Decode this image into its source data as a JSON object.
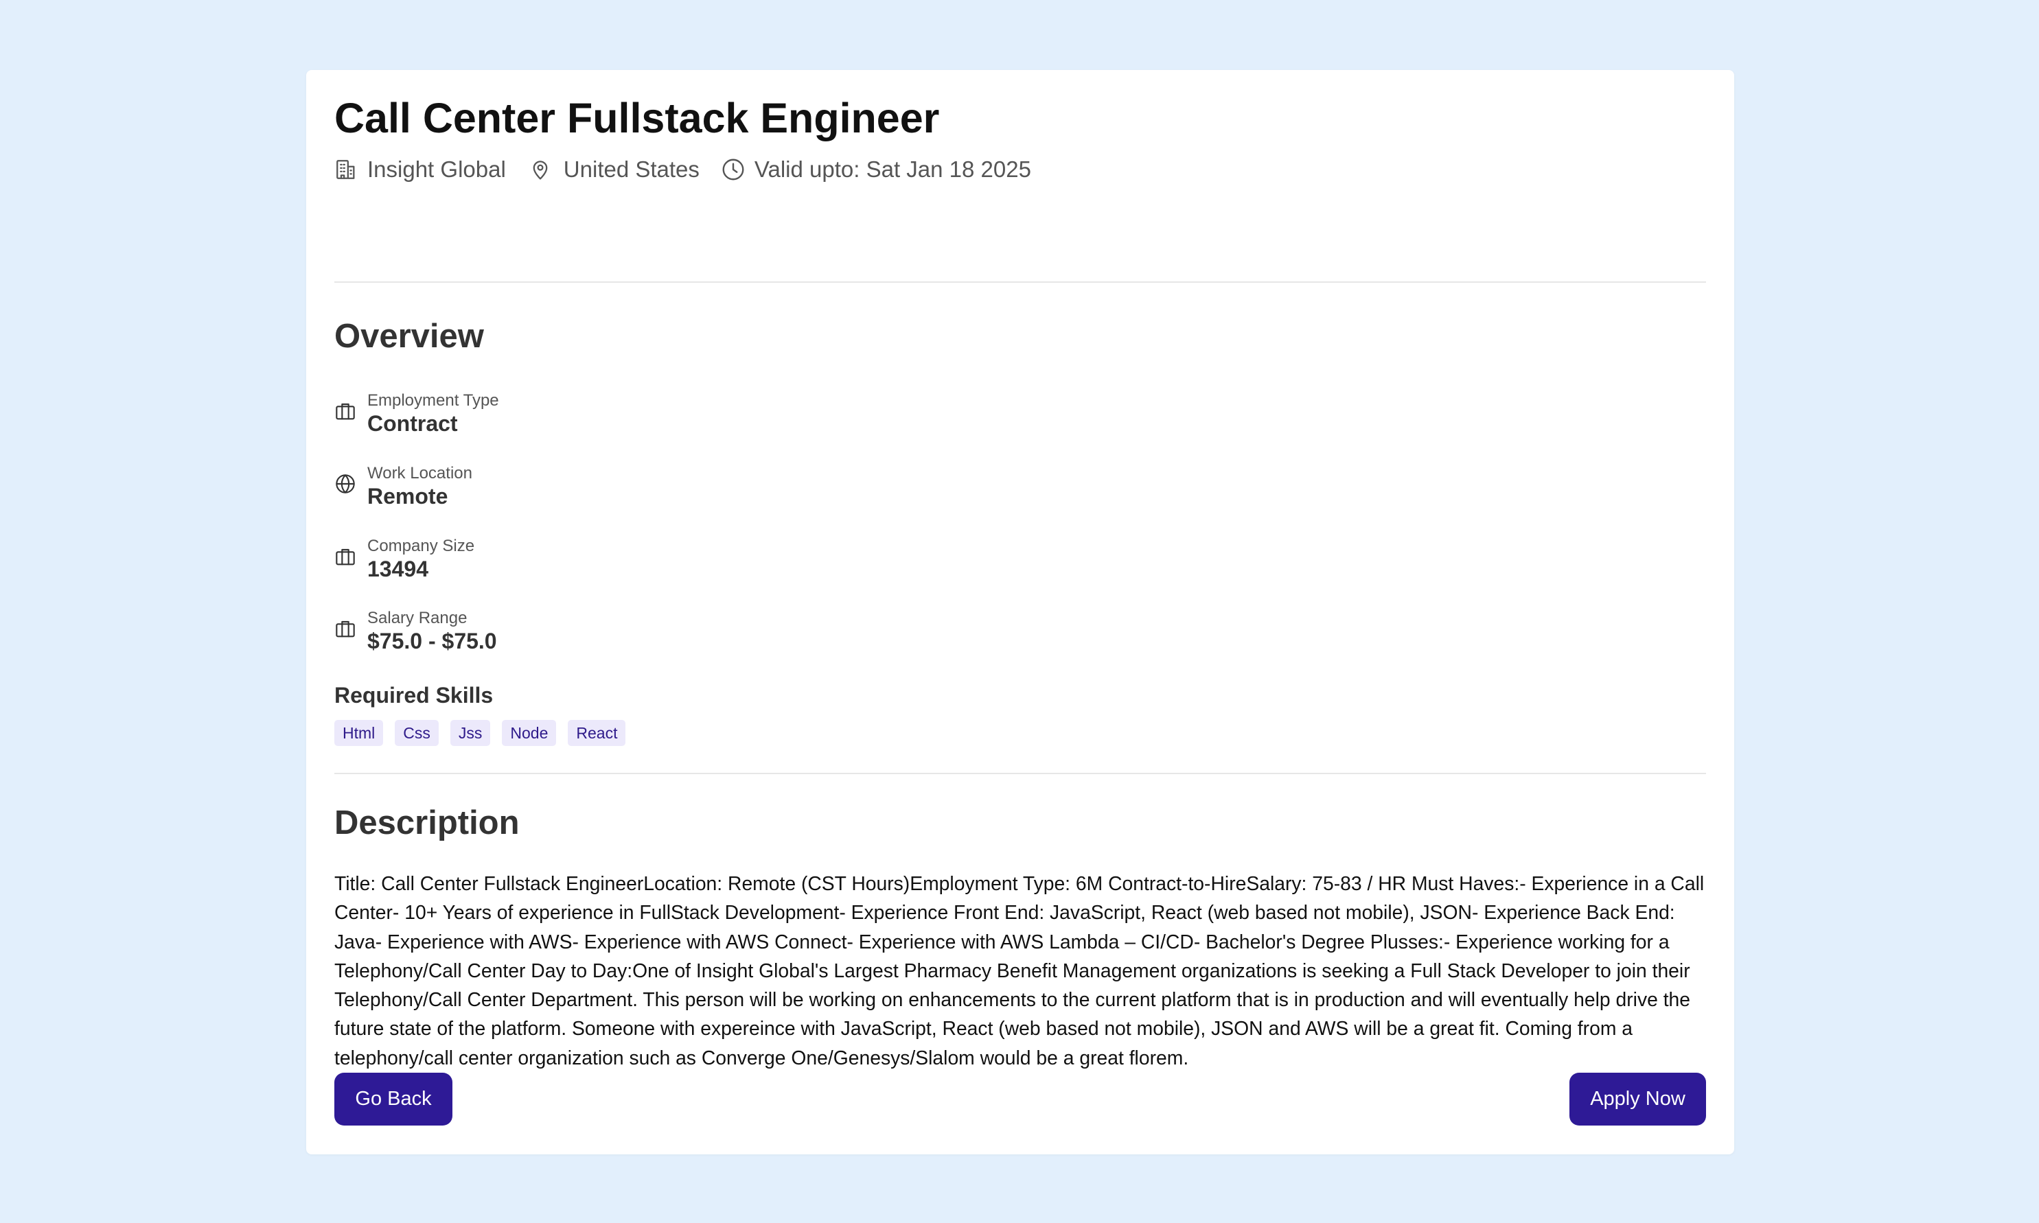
{
  "job": {
    "title": "Call Center Fullstack Engineer",
    "company": "Insight Global",
    "location": "United States",
    "valid_until": "Valid upto: Sat Jan 18 2025"
  },
  "overview": {
    "heading": "Overview",
    "items": [
      {
        "label": "Employment Type",
        "value": "Contract",
        "icon": "briefcase-icon"
      },
      {
        "label": "Work Location",
        "value": "Remote",
        "icon": "globe-icon"
      },
      {
        "label": "Company Size",
        "value": "13494",
        "icon": "briefcase-icon"
      },
      {
        "label": "Salary Range",
        "value": "$75.0 - $75.0",
        "icon": "briefcase-icon"
      }
    ]
  },
  "skills": {
    "heading": "Required Skills",
    "items": [
      "Html",
      "Css",
      "Jss",
      "Node",
      "React"
    ]
  },
  "description": {
    "heading": "Description",
    "text": "Title: Call Center Fullstack EngineerLocation: Remote (CST Hours)Employment Type: 6M Contract-to-HireSalary: 75-83 / HR Must Haves:- Experience in a Call Center- 10+ Years of experience in FullStack Development- Experience Front End: JavaScript, React (web based not mobile), JSON- Experience Back End: Java- Experience with AWS- Experience with AWS Connect- Experience with AWS Lambda – CI/CD- Bachelor's Degree Plusses:- Experience working for a Telephony/Call Center Day to Day:One of Insight Global's Largest Pharmacy Benefit Management organizations is seeking a Full Stack Developer to join their Telephony/Call Center Department. This person will be working on enhancements to the current platform that is in production and will eventually help drive the future state of the platform. Someone with expereince with JavaScript, React (web based not mobile), JSON and AWS will be a great fit. Coming from a telephony/call center organization such as Converge One/Genesys/Slalom would be a great florem."
  },
  "actions": {
    "back_label": "Go Back",
    "apply_label": "Apply Now"
  },
  "colors": {
    "page_background": "#e2effc",
    "card_background": "#ffffff",
    "accent": "#2e1a96",
    "skill_chip_background": "#ece9fb",
    "skill_chip_text": "#2e1a8a"
  }
}
